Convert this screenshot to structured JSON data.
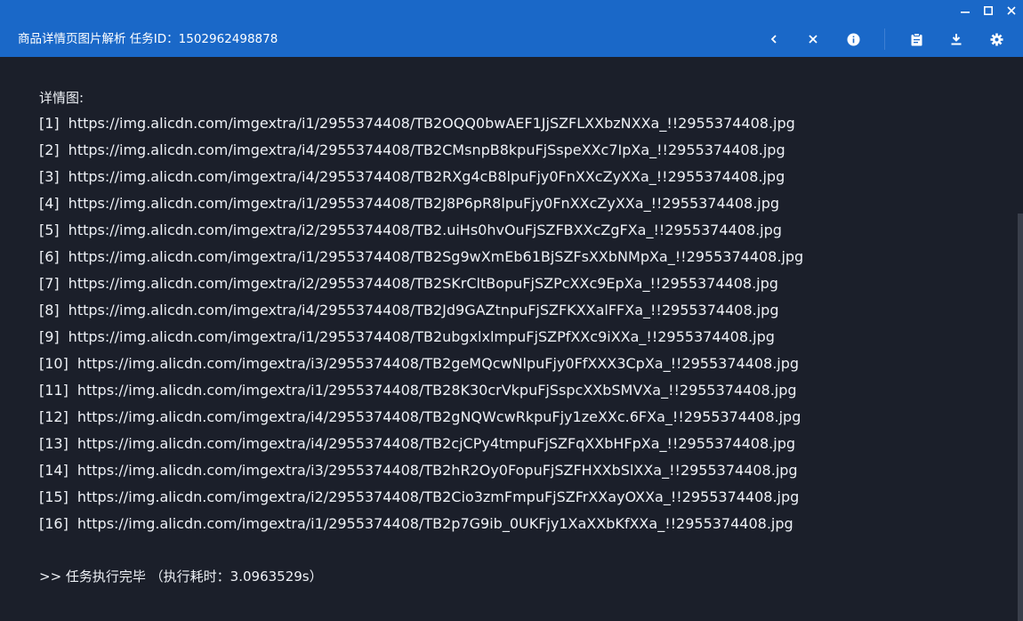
{
  "window": {
    "title": "商品详情页图片解析 任务ID：1502962498878",
    "controls": [
      "minimize",
      "maximize",
      "close"
    ]
  },
  "toolbar": {
    "icons": [
      "chevron-left-icon",
      "close-icon",
      "info-icon",
      "clipboard-icon",
      "download-icon",
      "gear-icon"
    ]
  },
  "main": {
    "heading": "详情图:",
    "urls": [
      {
        "index": "[1]",
        "url": "https://img.alicdn.com/imgextra/i1/2955374408/TB2OQQ0bwAEF1JjSZFLXXbzNXXa_!!2955374408.jpg"
      },
      {
        "index": "[2]",
        "url": "https://img.alicdn.com/imgextra/i4/2955374408/TB2CMsnpB8kpuFjSspeXXc7IpXa_!!2955374408.jpg"
      },
      {
        "index": "[3]",
        "url": "https://img.alicdn.com/imgextra/i4/2955374408/TB2RXg4cB8lpuFjy0FnXXcZyXXa_!!2955374408.jpg"
      },
      {
        "index": "[4]",
        "url": "https://img.alicdn.com/imgextra/i1/2955374408/TB2J8P6pR8lpuFjy0FnXXcZyXXa_!!2955374408.jpg"
      },
      {
        "index": "[5]",
        "url": "https://img.alicdn.com/imgextra/i2/2955374408/TB2.uiHs0hvOuFjSZFBXXcZgFXa_!!2955374408.jpg"
      },
      {
        "index": "[6]",
        "url": "https://img.alicdn.com/imgextra/i1/2955374408/TB2Sg9wXmEb61BjSZFsXXbNMpXa_!!2955374408.jpg"
      },
      {
        "index": "[7]",
        "url": "https://img.alicdn.com/imgextra/i2/2955374408/TB2SKrCltBopuFjSZPcXXc9EpXa_!!2955374408.jpg"
      },
      {
        "index": "[8]",
        "url": "https://img.alicdn.com/imgextra/i4/2955374408/TB2Jd9GAZtnpuFjSZFKXXalFFXa_!!2955374408.jpg"
      },
      {
        "index": "[9]",
        "url": "https://img.alicdn.com/imgextra/i1/2955374408/TB2ubgxlxlmpuFjSZPfXXc9iXXa_!!2955374408.jpg"
      },
      {
        "index": "[10]",
        "url": "https://img.alicdn.com/imgextra/i3/2955374408/TB2geMQcwNlpuFjy0FfXXX3CpXa_!!2955374408.jpg"
      },
      {
        "index": "[11]",
        "url": "https://img.alicdn.com/imgextra/i1/2955374408/TB28K30crVkpuFjSspcXXbSMVXa_!!2955374408.jpg"
      },
      {
        "index": "[12]",
        "url": "https://img.alicdn.com/imgextra/i4/2955374408/TB2gNQWcwRkpuFjy1zeXXc.6FXa_!!2955374408.jpg"
      },
      {
        "index": "[13]",
        "url": "https://img.alicdn.com/imgextra/i4/2955374408/TB2cjCPy4tmpuFjSZFqXXbHFpXa_!!2955374408.jpg"
      },
      {
        "index": "[14]",
        "url": "https://img.alicdn.com/imgextra/i3/2955374408/TB2hR2Oy0FopuFjSZFHXXbSlXXa_!!2955374408.jpg"
      },
      {
        "index": "[15]",
        "url": "https://img.alicdn.com/imgextra/i2/2955374408/TB2Cio3zmFmpuFjSZFrXXayOXXa_!!2955374408.jpg"
      },
      {
        "index": "[16]",
        "url": "https://img.alicdn.com/imgextra/i1/2955374408/TB2p7G9ib_0UKFjy1XaXXbKfXXa_!!2955374408.jpg"
      }
    ],
    "footer": ">> 任务执行完毕 （执行耗时：3.0963529s）"
  },
  "colors": {
    "titlebar": "#1a68c8",
    "background": "#1b1f2a",
    "text": "#eef1f6"
  }
}
